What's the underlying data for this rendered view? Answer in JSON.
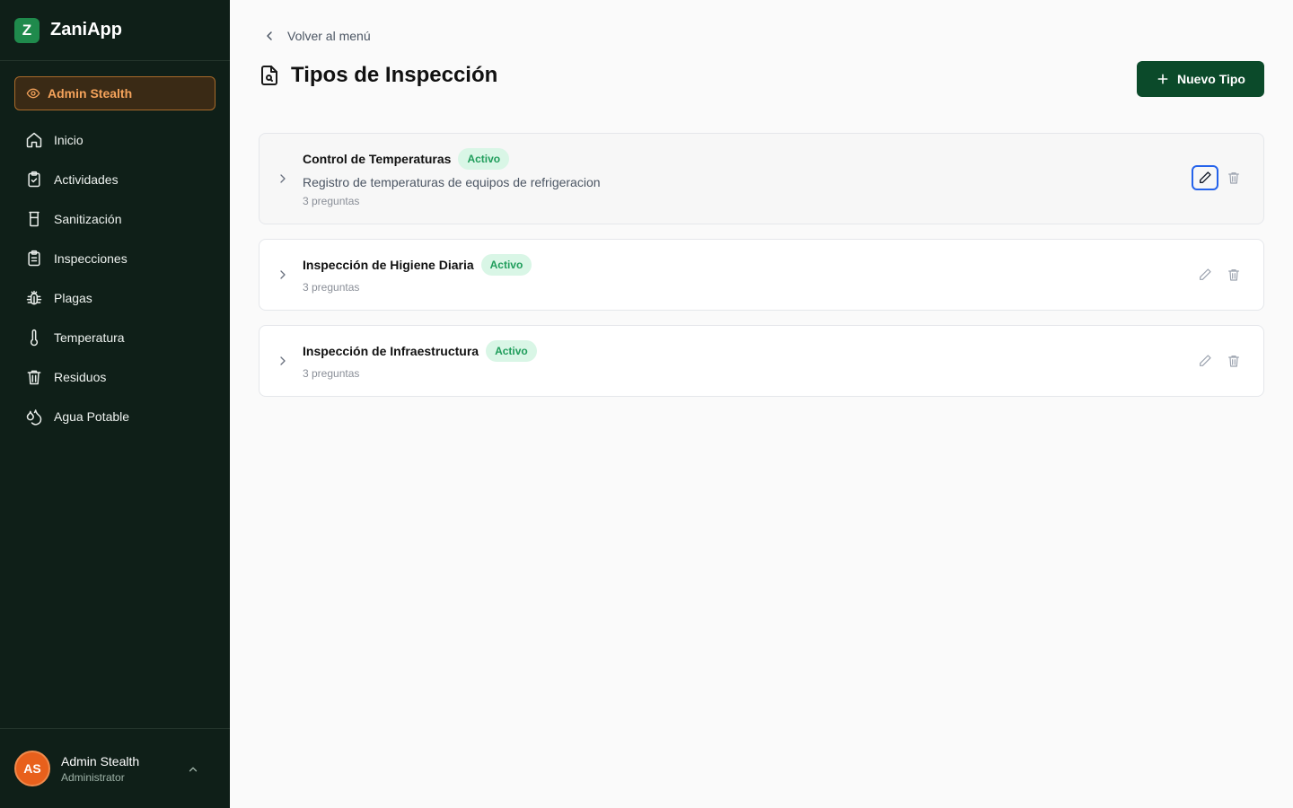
{
  "app": {
    "logo_letter": "Z",
    "name": "ZaniApp"
  },
  "stealth": {
    "label": "Admin Stealth"
  },
  "sidebar": {
    "items": [
      {
        "label": "Inicio",
        "icon": "home-icon"
      },
      {
        "label": "Actividades",
        "icon": "clipboard-check-icon"
      },
      {
        "label": "Sanitización",
        "icon": "glass-icon"
      },
      {
        "label": "Inspecciones",
        "icon": "clipboard-list-icon"
      },
      {
        "label": "Plagas",
        "icon": "bug-icon"
      },
      {
        "label": "Temperatura",
        "icon": "thermometer-icon"
      },
      {
        "label": "Residuos",
        "icon": "trash-icon"
      },
      {
        "label": "Agua Potable",
        "icon": "droplets-icon"
      }
    ]
  },
  "user": {
    "initials": "AS",
    "name": "Admin Stealth",
    "role": "Administrator"
  },
  "main": {
    "back_label": "Volver al menú",
    "title": "Tipos de Inspección",
    "new_button": "Nuevo Tipo",
    "types": [
      {
        "title": "Control de Temperaturas",
        "status": "Activo",
        "description": "Registro de temperaturas de equipos de refrigeracion",
        "count": "3 preguntas"
      },
      {
        "title": "Inspección de Higiene Diaria",
        "status": "Activo",
        "count": "3 preguntas"
      },
      {
        "title": "Inspección de Infraestructura",
        "status": "Activo",
        "count": "3 preguntas"
      }
    ]
  },
  "colors": {
    "sidebar_bg": "#0f1f18",
    "accent": "#0b4a2a",
    "stealth": "#f5a35b",
    "badge_bg": "#d9f6e6",
    "badge_text": "#1f9d5b",
    "avatar": "#e8601c"
  }
}
